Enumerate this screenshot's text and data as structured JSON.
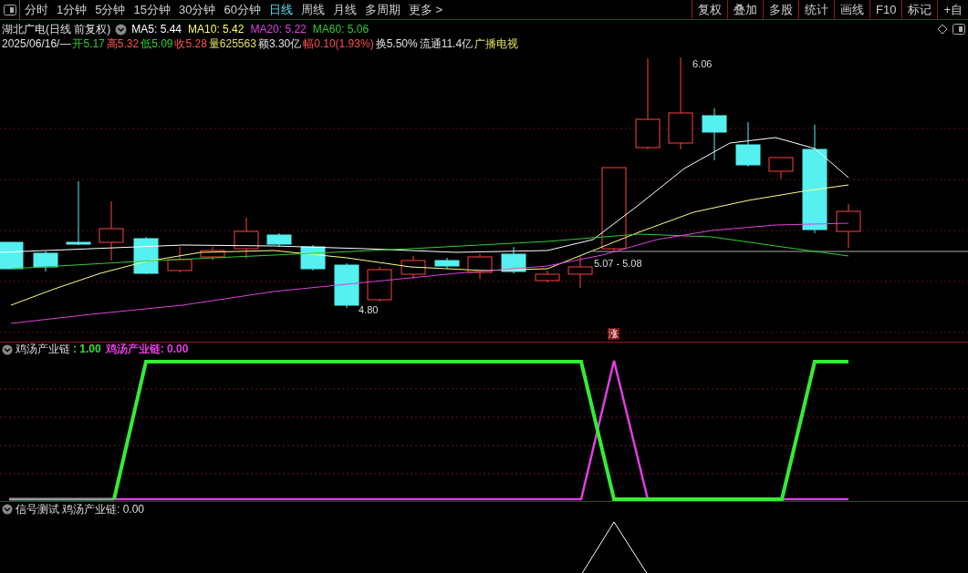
{
  "toolbar": {
    "period_tabs": [
      {
        "label": "分时",
        "selected": false
      },
      {
        "label": "1分钟",
        "selected": false
      },
      {
        "label": "5分钟",
        "selected": false
      },
      {
        "label": "15分钟",
        "selected": false
      },
      {
        "label": "30分钟",
        "selected": false
      },
      {
        "label": "60分钟",
        "selected": false
      },
      {
        "label": "日线",
        "selected": true
      },
      {
        "label": "周线",
        "selected": false
      },
      {
        "label": "月线",
        "selected": false
      },
      {
        "label": "多周期",
        "selected": false
      },
      {
        "label": "更多 >",
        "selected": false
      }
    ],
    "buttons": [
      "复权",
      "叠加",
      "多股",
      "统计",
      "画线",
      "F10",
      "标记",
      "+自"
    ]
  },
  "chart_header": {
    "title": "湖北广电(日线 前复权)",
    "ma_legend": [
      {
        "text": "MA5: 5.44",
        "color": "#ffffff"
      },
      {
        "text": "MA10: 5.42",
        "color": "#ffff66"
      },
      {
        "text": "MA20: 5.22",
        "color": "#e040e0"
      },
      {
        "text": "MA60: 5.06",
        "color": "#33cc33"
      }
    ],
    "quote": [
      {
        "text": "2025/06/16/—",
        "color": "#e0e0e0"
      },
      {
        "text": "开5.17",
        "color": "#33cc33"
      },
      {
        "text": "高5.32",
        "color": "#ff5050"
      },
      {
        "text": "低5.09",
        "color": "#33cc33"
      },
      {
        "text": "收5.28",
        "color": "#ff5050"
      },
      {
        "text": "量625563",
        "color": "#e0e060"
      },
      {
        "text": "额3.30亿",
        "color": "#e0e0e0"
      },
      {
        "text": "幅0.10(1.93%)",
        "color": "#ff5050"
      },
      {
        "text": "换5.50%",
        "color": "#e0e0e0"
      },
      {
        "text": "流通11.4亿",
        "color": "#e0e0e0"
      },
      {
        "text": "广播电视",
        "color": "#e0e060"
      }
    ]
  },
  "price_chart": {
    "high_label": "6.06",
    "low_label": "4.80",
    "range_label": "5.07 - 5.08",
    "rise_marker": "涨"
  },
  "indicator_panel": {
    "name": "鸡汤产业链",
    "values": [
      {
        "text": ": 1.00",
        "color": "#33dd33"
      },
      {
        "text": "鸡汤产业链: 0.00",
        "color": "#e040e0"
      }
    ]
  },
  "signal_panel": {
    "name": "信号测试",
    "value": "鸡汤产业链: 0.00"
  }
}
